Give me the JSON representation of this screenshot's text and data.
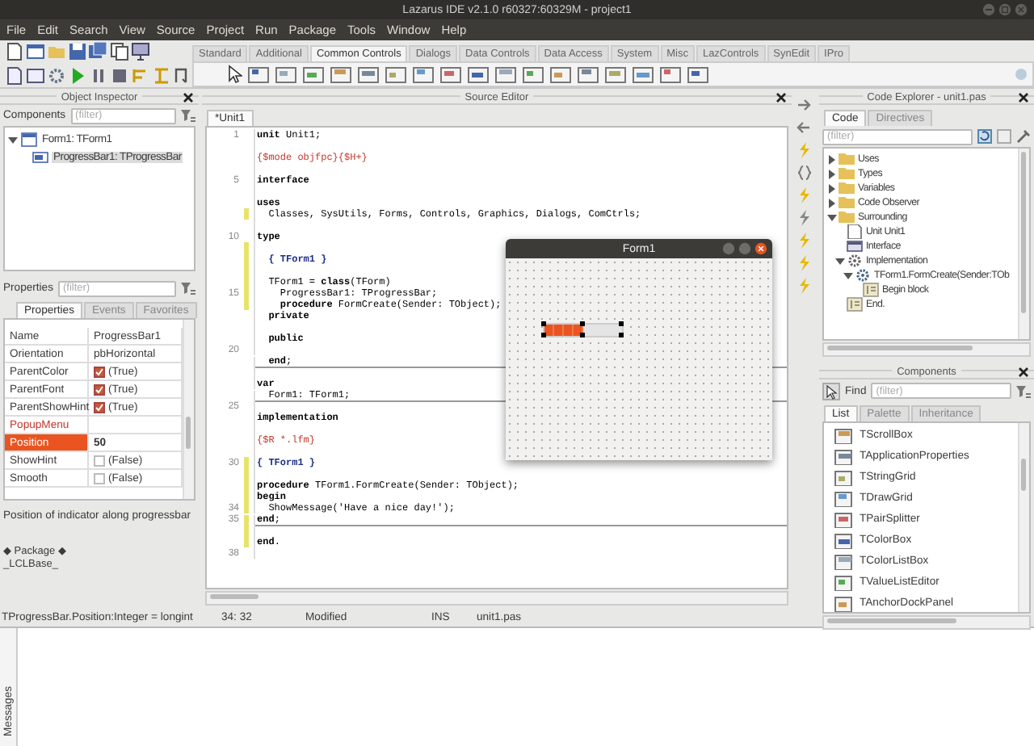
{
  "window": {
    "title": "Lazarus IDE v2.1.0 r60327:60329M - project1"
  },
  "menu": [
    "File",
    "Edit",
    "Search",
    "View",
    "Source",
    "Project",
    "Run",
    "Package",
    "Tools",
    "Window",
    "Help"
  ],
  "palette": {
    "tabs": [
      {
        "label": "Standard",
        "selected": false
      },
      {
        "label": "Additional",
        "selected": false
      },
      {
        "label": "Common Controls",
        "selected": true
      },
      {
        "label": "Dialogs",
        "selected": false
      },
      {
        "label": "Data Controls",
        "selected": false
      },
      {
        "label": "Data Access",
        "selected": false
      },
      {
        "label": "System",
        "selected": false
      },
      {
        "label": "Misc",
        "selected": false
      },
      {
        "label": "LazControls",
        "selected": false
      },
      {
        "label": "SynEdit",
        "selected": false
      },
      {
        "label": "IPro",
        "selected": false
      }
    ]
  },
  "object_inspector": {
    "title": "Object Inspector",
    "components_label": "Components",
    "components_filter": {
      "placeholder": "(filter)"
    },
    "tree": [
      {
        "label": "Form1: TForm1",
        "kind": "form",
        "expanded": true,
        "selected": false,
        "children": [
          {
            "label": "ProgressBar1: TProgressBar",
            "kind": "progress",
            "selected": true
          }
        ]
      }
    ],
    "properties_label": "Properties",
    "properties_filter": {
      "placeholder": "(filter)"
    },
    "tabs": [
      {
        "label": "Properties",
        "selected": true
      },
      {
        "label": "Events",
        "selected": false
      },
      {
        "label": "Favorites",
        "selected": false
      }
    ],
    "properties": [
      {
        "name": "Name",
        "kind": "text",
        "value": "ProgressBar1",
        "selected": false
      },
      {
        "name": "Orientation",
        "kind": "text",
        "value": "pbHorizontal",
        "selected": false
      },
      {
        "name": "ParentColor",
        "kind": "bool",
        "value": "(True)",
        "checked": true,
        "selected": false
      },
      {
        "name": "ParentFont",
        "kind": "bool",
        "value": "(True)",
        "checked": true,
        "selected": false
      },
      {
        "name": "ParentShowHint",
        "kind": "bool",
        "value": "(True)",
        "checked": true,
        "selected": false
      },
      {
        "name": "PopupMenu",
        "kind": "reference",
        "selected": false
      },
      {
        "name": "Position",
        "kind": "text",
        "value": "50",
        "selected": true
      },
      {
        "name": "ShowHint",
        "kind": "bool",
        "value": "(False)",
        "checked": false,
        "selected": false
      },
      {
        "name": "Smooth",
        "kind": "bool",
        "value": "(False)",
        "checked": false,
        "selected": false
      }
    ],
    "description": "Position of indicator along progressbar",
    "package": "◆ Package ◆",
    "package_name": "_LCLBase_",
    "status": "TProgressBar.Position:Integer = longint"
  },
  "source_editor": {
    "title": "Source Editor",
    "tabs": [
      {
        "label": "*Unit1",
        "selected": true
      }
    ],
    "lines": [
      {
        "number": "1",
        "kind": "code",
        "text": "**unit** Unit1;"
      },
      {
        "kind": "code"
      },
      {
        "kind": "directive",
        "text": "{$mode objfpc}{$H+}"
      },
      {
        "kind": "code"
      },
      {
        "number": "5",
        "kind": "code",
        "text": "**interface**"
      },
      {
        "kind": "code"
      },
      {
        "kind": "code",
        "text": "**uses**"
      },
      {
        "kind": "code",
        "text": "  Classes, SysUtils, Forms, Controls, Graphics, Dialogs, ComCtrls;",
        "modified": true
      },
      {
        "kind": "code"
      },
      {
        "number": "10",
        "kind": "code",
        "text": "**type**"
      },
      {
        "kind": "code",
        "modified": true
      },
      {
        "kind": "comment",
        "text": "  { TForm1 }",
        "modified": true
      },
      {
        "kind": "code",
        "modified": true
      },
      {
        "kind": "code",
        "text": "  TForm1 = **class**(TForm)",
        "modified": true
      },
      {
        "number": "15",
        "kind": "code",
        "text": "    ProgressBar1: TProgressBar;",
        "modified": true
      },
      {
        "kind": "code",
        "text": "    **procedure** FormCreate(Sender: TObject);",
        "modified": true
      },
      {
        "kind": "code",
        "text": "  **private**"
      },
      {
        "kind": "code"
      },
      {
        "kind": "code",
        "text": "  **public**"
      },
      {
        "number": "20",
        "kind": "code"
      },
      {
        "kind": "code",
        "text": "  **end**;",
        "divider": true
      },
      {
        "kind": "code"
      },
      {
        "kind": "code",
        "text": "**var**"
      },
      {
        "kind": "code",
        "text": "  Form1: TForm1;",
        "divider": true
      },
      {
        "number": "25",
        "kind": "code"
      },
      {
        "kind": "code",
        "text": "**implementation**"
      },
      {
        "kind": "code"
      },
      {
        "kind": "directive",
        "text": "{$R *.lfm}"
      },
      {
        "kind": "code"
      },
      {
        "number": "30",
        "kind": "comment",
        "text": "{ TForm1 }",
        "modified": true
      },
      {
        "kind": "code",
        "modified": true
      },
      {
        "kind": "code",
        "text": "**procedure** TForm1.FormCreate(Sender: TObject);",
        "modified": true
      },
      {
        "kind": "code",
        "text": "**begin**",
        "modified": true
      },
      {
        "number": "34",
        "kind": "code",
        "text": "  ShowMessage('Have a nice day!');",
        "modified": true
      },
      {
        "number": "35",
        "kind": "code",
        "text": "**end**;",
        "modified": true,
        "divider": true
      },
      {
        "kind": "code",
        "modified": true
      },
      {
        "kind": "code",
        "text": "**end**.",
        "modified": true
      },
      {
        "number": "38",
        "kind": "code"
      }
    ],
    "status": {
      "position": "34: 32",
      "state": "Modified",
      "mode": "INS",
      "file": "unit1.pas"
    }
  },
  "form_designer": {
    "title": "Form1",
    "progress_bar": {
      "level": 0.5,
      "selected": true
    }
  },
  "code_explorer": {
    "title": "Code Explorer - unit1.pas",
    "tabs": [
      {
        "label": "Code",
        "selected": true
      },
      {
        "label": "Directives",
        "selected": false
      }
    ],
    "filter": {
      "placeholder": "(filter)"
    },
    "tree": [
      {
        "label": "Uses",
        "kind": "folder",
        "expanded": false
      },
      {
        "label": "Types",
        "kind": "folder",
        "expanded": false
      },
      {
        "label": "Variables",
        "kind": "folder",
        "expanded": false
      },
      {
        "label": "Code Observer",
        "kind": "folder",
        "expanded": false
      },
      {
        "label": "Surrounding",
        "kind": "folder",
        "expanded": true,
        "children": [
          {
            "label": "Unit Unit1",
            "kind": "page"
          },
          {
            "label": "Interface",
            "kind": "section"
          },
          {
            "label": "Implementation",
            "kind": "gear",
            "expanded": true,
            "children": [
              {
                "label": "TForm1.FormCreate(Sender:TOb",
                "kind": "method",
                "expanded": true,
                "children": [
                  {
                    "label": "Begin block",
                    "kind": "block"
                  }
                ]
              }
            ]
          },
          {
            "label": "End.",
            "kind": "block"
          }
        ]
      }
    ]
  },
  "components": {
    "title": "Components",
    "find_label": "Find",
    "filter": {
      "placeholder": "(filter)"
    },
    "tabs": [
      {
        "label": "List",
        "selected": true
      },
      {
        "label": "Palette",
        "selected": false
      },
      {
        "label": "Inheritance",
        "selected": false
      }
    ],
    "items": [
      "TScrollBox",
      "TApplicationProperties",
      "TStringGrid",
      "TDrawGrid",
      "TPairSplitter",
      "TColorBox",
      "TColorListBox",
      "TValueListEditor",
      "TAnchorDockPanel"
    ]
  },
  "messages": {
    "title": "Messages"
  }
}
